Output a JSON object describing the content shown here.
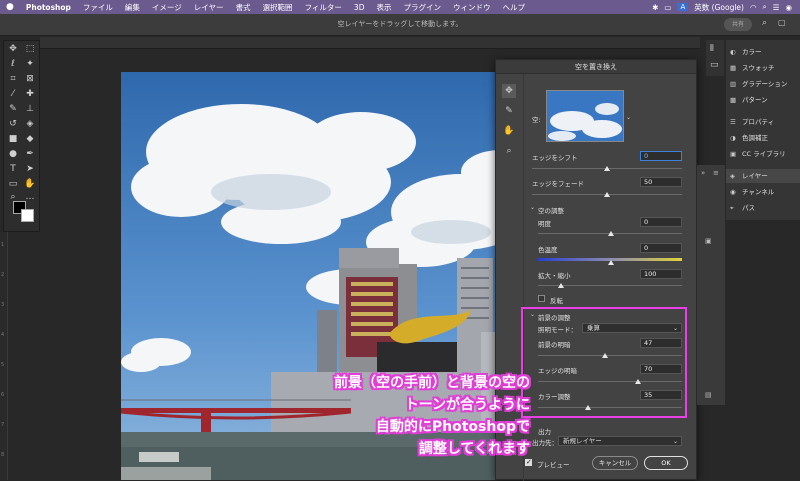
{
  "menubar": {
    "apple": "",
    "app": "Photoshop",
    "items": [
      "ファイル",
      "編集",
      "イメージ",
      "レイヤー",
      "書式",
      "選択範囲",
      "フィルター",
      "3D",
      "表示",
      "プラグイン",
      "ウィンドウ",
      "ヘルプ"
    ],
    "ime": "A",
    "ime_label": "英数 (Google)"
  },
  "optionsbar": {
    "hint": "空レイヤーをドラッグして移動します。",
    "share": "共有"
  },
  "dialog": {
    "title": "空を置き換え",
    "sky_label": "空:",
    "edge_shift": {
      "label": "エッジをシフト",
      "value": "0"
    },
    "edge_fade": {
      "label": "エッジをフェード",
      "value": "50"
    },
    "sky_adjust": {
      "header": "空の調整"
    },
    "brightness": {
      "label": "明度",
      "value": "0"
    },
    "temperature": {
      "label": "色温度",
      "value": "0"
    },
    "scale": {
      "label": "拡大・縮小",
      "value": "100"
    },
    "flip": {
      "label": "反転"
    },
    "fg_adjust": {
      "header": "前景の調整"
    },
    "lighting_mode": {
      "label": "照明モード：",
      "value": "乗算"
    },
    "fg_lighting": {
      "label": "前景の明暗",
      "value": "47"
    },
    "edge_lighting": {
      "label": "エッジの明暗",
      "value": "70"
    },
    "color_adjust": {
      "label": "カラー調整",
      "value": "35"
    },
    "output": {
      "header": "出力",
      "label": "出力先：",
      "value": "新規レイヤー"
    },
    "preview": "プレビュー",
    "cancel": "キャンセル",
    "ok": "OK"
  },
  "panels": {
    "items": [
      {
        "icon": "palette-icon",
        "label": "カラー"
      },
      {
        "icon": "swatches-icon",
        "label": "スウォッチ"
      },
      {
        "icon": "gradient-icon",
        "label": "グラデーション"
      },
      {
        "icon": "pattern-icon",
        "label": "パターン"
      },
      {
        "icon": "properties-icon",
        "label": "プロパティ"
      },
      {
        "icon": "adjustments-icon",
        "label": "色調補正"
      },
      {
        "icon": "cc-libraries-icon",
        "label": "CC ライブラリ"
      },
      {
        "icon": "layers-icon",
        "label": "レイヤー"
      },
      {
        "icon": "channels-icon",
        "label": "チャンネル"
      },
      {
        "icon": "paths-icon",
        "label": "パス"
      }
    ]
  },
  "caption": {
    "lines": [
      "前景（空の手前）と背景の空の",
      "トーンが合うように",
      "自動的にPhotoshopで",
      "調整してくれます"
    ],
    "color": "#e23dd8"
  },
  "ruler_labels": [
    "1",
    "2",
    "3",
    "4",
    "5",
    "6",
    "7",
    "8"
  ]
}
